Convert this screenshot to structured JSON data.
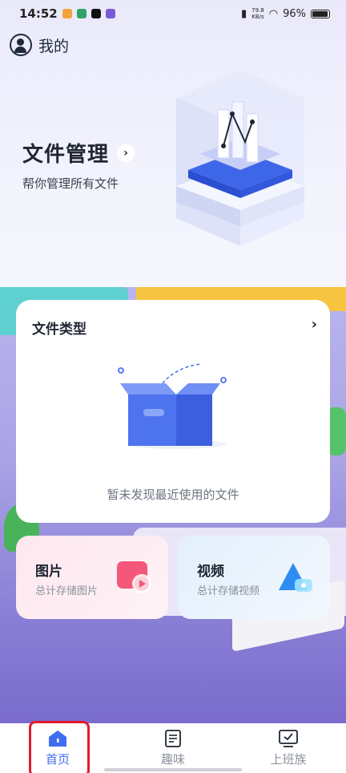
{
  "status_bar": {
    "time": "14:52",
    "net_speed_value": "79.8",
    "net_speed_unit": "KB/s",
    "battery": "96%"
  },
  "header": {
    "profile_label": "我的"
  },
  "hero": {
    "title": "文件管理",
    "subtitle": "帮你管理所有文件"
  },
  "file_type_card": {
    "title": "文件类型",
    "empty_text": "暂未发现最近使用的文件"
  },
  "categories": [
    {
      "title": "图片",
      "subtitle": "总计存储图片",
      "icon": "image-icon"
    },
    {
      "title": "视频",
      "subtitle": "总计存储视频",
      "icon": "video-icon"
    }
  ],
  "bottom_nav": [
    {
      "label": "首页",
      "icon": "home-icon",
      "active": true
    },
    {
      "label": "趣味",
      "icon": "document-icon",
      "active": false
    },
    {
      "label": "上班族",
      "icon": "checkbox-board-icon",
      "active": false
    }
  ],
  "colors": {
    "accent": "#3e6ef0",
    "highlight": "#e01c2c"
  }
}
